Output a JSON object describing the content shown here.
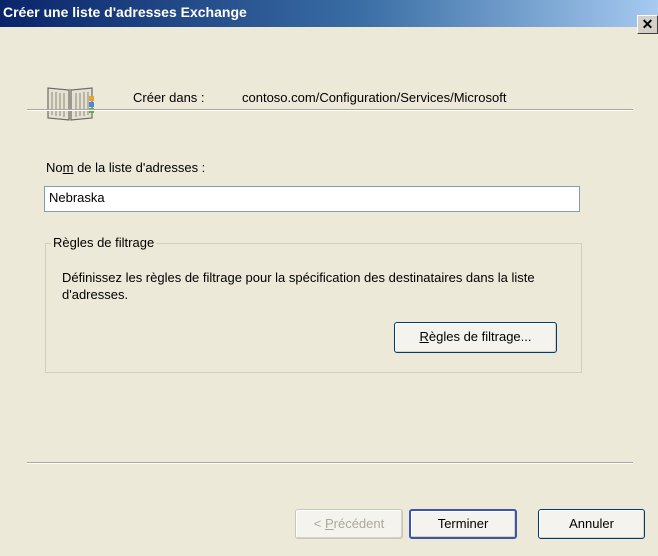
{
  "window": {
    "title": "Créer une liste d'adresses Exchange",
    "close_glyph": "✕"
  },
  "header": {
    "create_in_label": "Créer dans :",
    "create_in_path": "contoso.com/Configuration/Services/Microsoft",
    "icon": "address-book-icon"
  },
  "form": {
    "name_label_pre": "No",
    "name_label_mnemonic": "m",
    "name_label_post": " de la liste d'adresses :",
    "name_value": "Nebraska"
  },
  "filter_group": {
    "legend": "Règles de filtrage",
    "description": "Définissez les règles de filtrage pour la spécification des destinataires dans la liste d'adresses.",
    "button_mnemonic": "R",
    "button_rest": "ègles de filtrage..."
  },
  "footer": {
    "prev_pre": "< ",
    "prev_mnemonic": "P",
    "prev_rest": "récédent",
    "finish_label": "Terminer",
    "cancel_label": "Annuler"
  },
  "colors": {
    "title_bar_start": "#0a246a",
    "title_bar_end": "#a6caf0",
    "dialog_background": "#ece9d8"
  }
}
